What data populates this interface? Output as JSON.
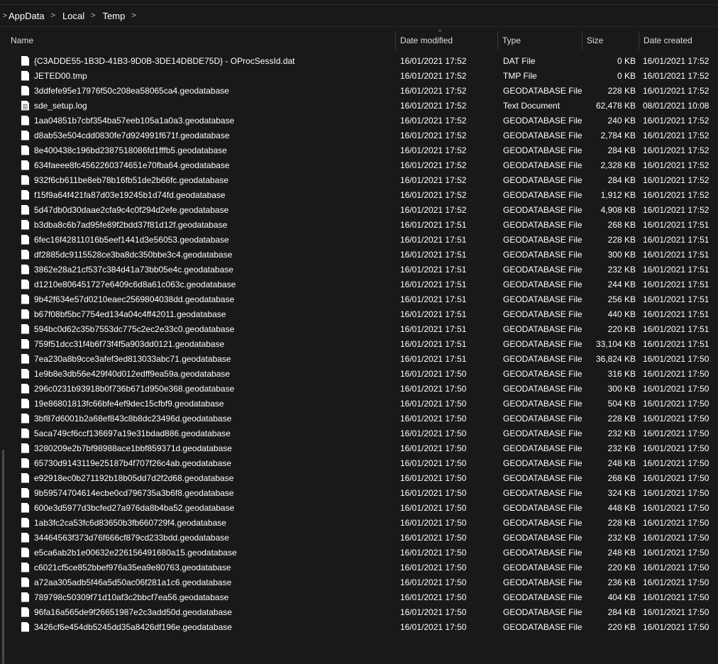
{
  "breadcrumb": {
    "items": [
      "AppData",
      "Local",
      "Temp"
    ],
    "separator": ">",
    "start_chevron": ">"
  },
  "columns": {
    "name": "Name",
    "date_modified": "Date modified",
    "type": "Type",
    "size": "Size",
    "date_created": "Date created",
    "sort_indicator": "^"
  },
  "files": [
    {
      "name": "{C3ADDE55-1B3D-41B3-9D0B-3DE14DBDE75D} - OProcSessId.dat",
      "modified": "16/01/2021 17:52",
      "type": "DAT File",
      "size": "0 KB",
      "created": "16/01/2021 17:52",
      "icon": "file-icon"
    },
    {
      "name": "JETED00.tmp",
      "modified": "16/01/2021 17:52",
      "type": "TMP File",
      "size": "0 KB",
      "created": "16/01/2021 17:52",
      "icon": "file-icon"
    },
    {
      "name": "3ddfefe95e17976f50c208ea58065ca4.geodatabase",
      "modified": "16/01/2021 17:52",
      "type": "GEODATABASE File",
      "size": "228 KB",
      "created": "16/01/2021 17:52",
      "icon": "file-icon"
    },
    {
      "name": "sde_setup.log",
      "modified": "16/01/2021 17:52",
      "type": "Text Document",
      "size": "62,478 KB",
      "created": "08/01/2021 10:08",
      "icon": "text-file-icon"
    },
    {
      "name": "1aa04851b7cbf354ba57eeb105a1a0a3.geodatabase",
      "modified": "16/01/2021 17:52",
      "type": "GEODATABASE File",
      "size": "240 KB",
      "created": "16/01/2021 17:52",
      "icon": "file-icon"
    },
    {
      "name": "d8ab53e504cdd0830fe7d924991f671f.geodatabase",
      "modified": "16/01/2021 17:52",
      "type": "GEODATABASE File",
      "size": "2,784 KB",
      "created": "16/01/2021 17:52",
      "icon": "file-icon"
    },
    {
      "name": "8e400438c196bd2387518086fd1fffb5.geodatabase",
      "modified": "16/01/2021 17:52",
      "type": "GEODATABASE File",
      "size": "284 KB",
      "created": "16/01/2021 17:52",
      "icon": "file-icon"
    },
    {
      "name": "634faeee8fc4562260374651e70fba64.geodatabase",
      "modified": "16/01/2021 17:52",
      "type": "GEODATABASE File",
      "size": "2,328 KB",
      "created": "16/01/2021 17:52",
      "icon": "file-icon"
    },
    {
      "name": "932f6cb611be8eb78b16fb51de2b66fc.geodatabase",
      "modified": "16/01/2021 17:52",
      "type": "GEODATABASE File",
      "size": "284 KB",
      "created": "16/01/2021 17:52",
      "icon": "file-icon"
    },
    {
      "name": "f15f9a64f421fa87d03e19245b1d74fd.geodatabase",
      "modified": "16/01/2021 17:52",
      "type": "GEODATABASE File",
      "size": "1,912 KB",
      "created": "16/01/2021 17:52",
      "icon": "file-icon"
    },
    {
      "name": "5d47db0d30daae2cfa9c4c0f294d2efe.geodatabase",
      "modified": "16/01/2021 17:52",
      "type": "GEODATABASE File",
      "size": "4,908 KB",
      "created": "16/01/2021 17:52",
      "icon": "file-icon"
    },
    {
      "name": "b3dba8c6b7ad95fe89f2bdd37f81d12f.geodatabase",
      "modified": "16/01/2021 17:51",
      "type": "GEODATABASE File",
      "size": "268 KB",
      "created": "16/01/2021 17:51",
      "icon": "file-icon"
    },
    {
      "name": "6fec16f42811016b5eef1441d3e56053.geodatabase",
      "modified": "16/01/2021 17:51",
      "type": "GEODATABASE File",
      "size": "228 KB",
      "created": "16/01/2021 17:51",
      "icon": "file-icon"
    },
    {
      "name": "df2885dc9115528ce3ba8dc350bbe3c4.geodatabase",
      "modified": "16/01/2021 17:51",
      "type": "GEODATABASE File",
      "size": "300 KB",
      "created": "16/01/2021 17:51",
      "icon": "file-icon"
    },
    {
      "name": "3862e28a21cf537c384d41a73bb05e4c.geodatabase",
      "modified": "16/01/2021 17:51",
      "type": "GEODATABASE File",
      "size": "232 KB",
      "created": "16/01/2021 17:51",
      "icon": "file-icon"
    },
    {
      "name": "d1210e806451727e6409c6d8a61c063c.geodatabase",
      "modified": "16/01/2021 17:51",
      "type": "GEODATABASE File",
      "size": "244 KB",
      "created": "16/01/2021 17:51",
      "icon": "file-icon"
    },
    {
      "name": "9b42f634e57d0210eaec2569804038dd.geodatabase",
      "modified": "16/01/2021 17:51",
      "type": "GEODATABASE File",
      "size": "256 KB",
      "created": "16/01/2021 17:51",
      "icon": "file-icon"
    },
    {
      "name": "b67f08bf5bc7754ed134a04c4ff42011.geodatabase",
      "modified": "16/01/2021 17:51",
      "type": "GEODATABASE File",
      "size": "440 KB",
      "created": "16/01/2021 17:51",
      "icon": "file-icon"
    },
    {
      "name": "594bc0d62c35b7553dc775c2ec2e33c0.geodatabase",
      "modified": "16/01/2021 17:51",
      "type": "GEODATABASE File",
      "size": "220 KB",
      "created": "16/01/2021 17:51",
      "icon": "file-icon"
    },
    {
      "name": "759f51dcc31f4b6f73f4f5a903dd0121.geodatabase",
      "modified": "16/01/2021 17:51",
      "type": "GEODATABASE File",
      "size": "33,104 KB",
      "created": "16/01/2021 17:51",
      "icon": "file-icon"
    },
    {
      "name": "7ea230a8b9cce3afef3ed813033abc71.geodatabase",
      "modified": "16/01/2021 17:51",
      "type": "GEODATABASE File",
      "size": "36,824 KB",
      "created": "16/01/2021 17:50",
      "icon": "file-icon"
    },
    {
      "name": "1e9b8e3db56e429f40d012edff9ea59a.geodatabase",
      "modified": "16/01/2021 17:50",
      "type": "GEODATABASE File",
      "size": "316 KB",
      "created": "16/01/2021 17:50",
      "icon": "file-icon"
    },
    {
      "name": "296c0231b93918b0f736b671d950e368.geodatabase",
      "modified": "16/01/2021 17:50",
      "type": "GEODATABASE File",
      "size": "300 KB",
      "created": "16/01/2021 17:50",
      "icon": "file-icon"
    },
    {
      "name": "19e86801813fc66bfe4ef9dec15cfbf9.geodatabase",
      "modified": "16/01/2021 17:50",
      "type": "GEODATABASE File",
      "size": "504 KB",
      "created": "16/01/2021 17:50",
      "icon": "file-icon"
    },
    {
      "name": "3bf87d6001b2a68ef843c8b8dc23496d.geodatabase",
      "modified": "16/01/2021 17:50",
      "type": "GEODATABASE File",
      "size": "228 KB",
      "created": "16/01/2021 17:50",
      "icon": "file-icon"
    },
    {
      "name": "5aca749cf6ccf136697a19e31bdad886.geodatabase",
      "modified": "16/01/2021 17:50",
      "type": "GEODATABASE File",
      "size": "232 KB",
      "created": "16/01/2021 17:50",
      "icon": "file-icon"
    },
    {
      "name": "3280209e2b7bf98988ace1bbf859371d.geodatabase",
      "modified": "16/01/2021 17:50",
      "type": "GEODATABASE File",
      "size": "232 KB",
      "created": "16/01/2021 17:50",
      "icon": "file-icon"
    },
    {
      "name": "65730d9143119e25187b4f707f26c4ab.geodatabase",
      "modified": "16/01/2021 17:50",
      "type": "GEODATABASE File",
      "size": "248 KB",
      "created": "16/01/2021 17:50",
      "icon": "file-icon"
    },
    {
      "name": "e92918ec0b271192b18b05dd7d2f2d68.geodatabase",
      "modified": "16/01/2021 17:50",
      "type": "GEODATABASE File",
      "size": "268 KB",
      "created": "16/01/2021 17:50",
      "icon": "file-icon"
    },
    {
      "name": "9b59574704614ecbe0cd796735a3b6f8.geodatabase",
      "modified": "16/01/2021 17:50",
      "type": "GEODATABASE File",
      "size": "324 KB",
      "created": "16/01/2021 17:50",
      "icon": "file-icon"
    },
    {
      "name": "600e3d5977d3bcfed27a976da8b4ba52.geodatabase",
      "modified": "16/01/2021 17:50",
      "type": "GEODATABASE File",
      "size": "448 KB",
      "created": "16/01/2021 17:50",
      "icon": "file-icon"
    },
    {
      "name": "1ab3fc2ca53fc6d83650b3fb660729f4.geodatabase",
      "modified": "16/01/2021 17:50",
      "type": "GEODATABASE File",
      "size": "228 KB",
      "created": "16/01/2021 17:50",
      "icon": "file-icon"
    },
    {
      "name": "34464563f373d76f666cf879cd233bdd.geodatabase",
      "modified": "16/01/2021 17:50",
      "type": "GEODATABASE File",
      "size": "232 KB",
      "created": "16/01/2021 17:50",
      "icon": "file-icon"
    },
    {
      "name": "e5ca6ab2b1e00632e226156491680a15.geodatabase",
      "modified": "16/01/2021 17:50",
      "type": "GEODATABASE File",
      "size": "248 KB",
      "created": "16/01/2021 17:50",
      "icon": "file-icon"
    },
    {
      "name": "c6021cf5ce852bbef976a35ea9e80763.geodatabase",
      "modified": "16/01/2021 17:50",
      "type": "GEODATABASE File",
      "size": "220 KB",
      "created": "16/01/2021 17:50",
      "icon": "file-icon"
    },
    {
      "name": "a72aa305adb5f46a5d50ac06f281a1c6.geodatabase",
      "modified": "16/01/2021 17:50",
      "type": "GEODATABASE File",
      "size": "236 KB",
      "created": "16/01/2021 17:50",
      "icon": "file-icon"
    },
    {
      "name": "789798c50309f71d10af3c2bbcf7ea56.geodatabase",
      "modified": "16/01/2021 17:50",
      "type": "GEODATABASE File",
      "size": "404 KB",
      "created": "16/01/2021 17:50",
      "icon": "file-icon"
    },
    {
      "name": "96fa16a565de9f26651987e2c3add50d.geodatabase",
      "modified": "16/01/2021 17:50",
      "type": "GEODATABASE File",
      "size": "284 KB",
      "created": "16/01/2021 17:50",
      "icon": "file-icon"
    },
    {
      "name": "3426cf6e454db5245dd35a8426df196e.geodatabase",
      "modified": "16/01/2021 17:50",
      "type": "GEODATABASE File",
      "size": "220 KB",
      "created": "16/01/2021 17:50",
      "icon": "file-icon"
    }
  ]
}
